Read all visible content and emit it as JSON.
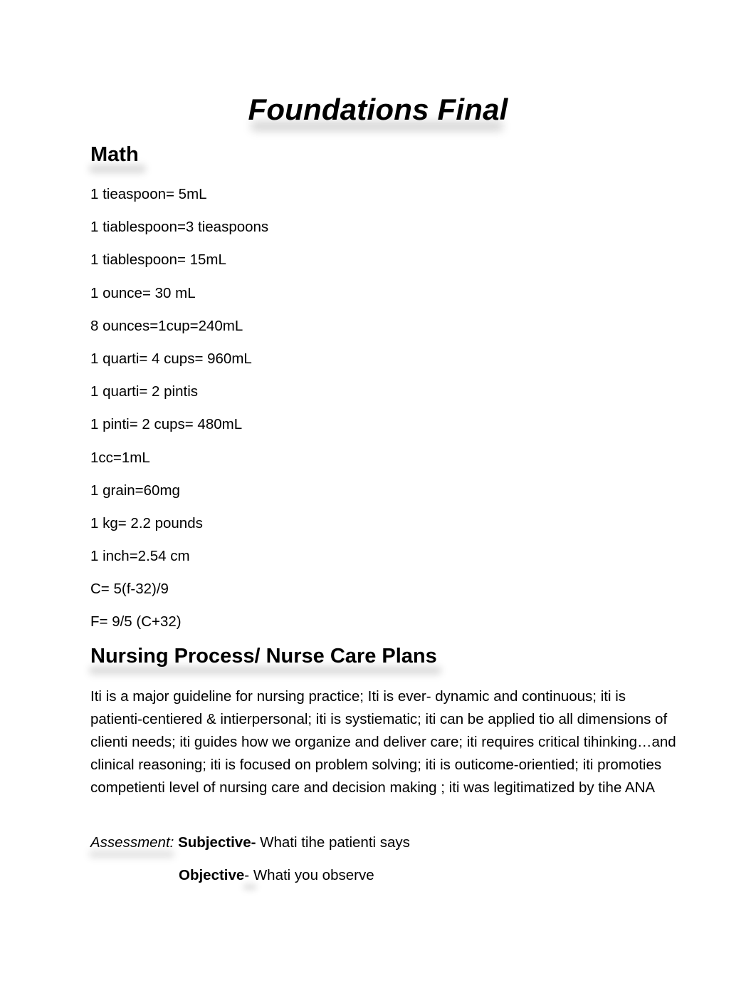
{
  "document": {
    "title": "Foundations Final",
    "sections": {
      "math": {
        "heading": "Math",
        "items": [
          "1 tieaspoon= 5mL",
          "1 tiablespoon=3 tieaspoons",
          "1 tiablespoon= 15mL",
          "1 ounce= 30 mL",
          "8 ounces=1cup=240mL",
          "1 quarti= 4 cups= 960mL",
          "1 quarti= 2 pintis",
          "1 pinti= 2 cups= 480mL",
          "1cc=1mL",
          "1 grain=60mg",
          "1 kg= 2.2 pounds",
          "1 inch=2.54 cm",
          "C= 5(f-32)/9",
          "F= 9/5 (C+32)"
        ]
      },
      "nursing_process": {
        "heading": "Nursing Process/ Nurse Care Plans",
        "paragraph": "Iti is a major guideline for nursing practice; Iti is ever- dynamic and continuous;  iti is patienti-centiered & intierpersonal; iti is systiematic; iti can be applied tio all dimensions of clienti needs; iti guides how we organize and deliver care; iti requires critical tihinking…and clinical reasoning; iti is focused on problem solving; iti is outicome-orientied; iti promoties competienti level of nursing care and decision making ; iti was legitimatized by tihe ANA",
        "assessment": {
          "label": "Assessment:",
          "subjective_label": "Subjective-",
          "subjective_text": " Whati tihe patienti says",
          "objective_label": "Objective",
          "objective_text": "- Whati you observe"
        }
      }
    }
  }
}
